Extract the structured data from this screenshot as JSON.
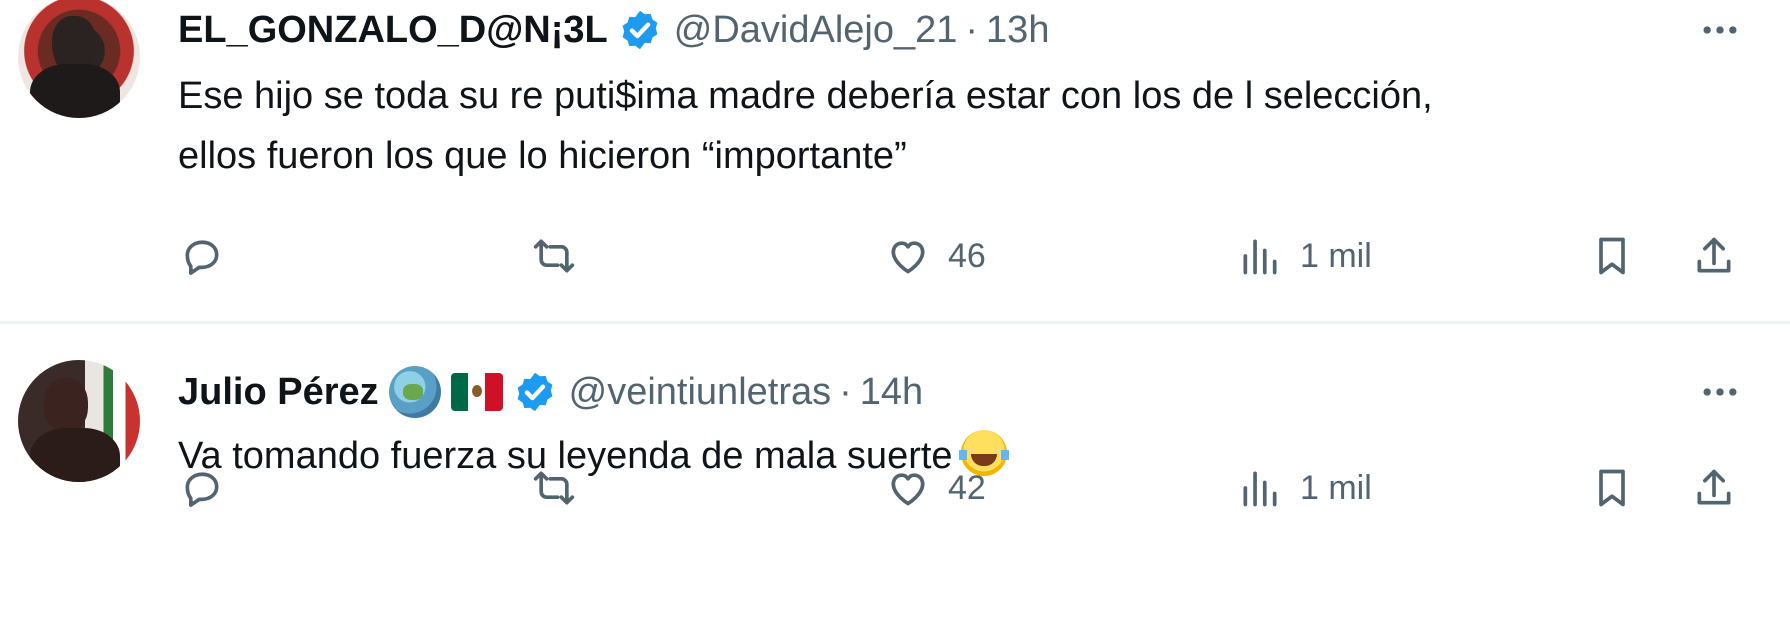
{
  "tweets": [
    {
      "name": "EL_GONZALO_D@N¡3L",
      "handle": "@DavidAlejo_21",
      "separator": "·",
      "time": "13h",
      "text_line1": "Ese hijo se toda su re puti$ima madre debería estar con los de l selección,",
      "text_line2": "ellos fueron los que lo hicieron “importante”",
      "likes": "46",
      "views": "1 mil"
    },
    {
      "name": "Julio Pérez",
      "handle": "@veintiunletras",
      "separator": "·",
      "time": "14h",
      "text": "Va tomando fuerza su leyenda de mala suerte",
      "emoji_name": "face-with-tears-of-joy",
      "likes": "42",
      "views": "1 mil"
    }
  ],
  "colors": {
    "verified": "#1d9bf0",
    "secondary_text": "#536471",
    "primary_text": "#0f1419",
    "divider": "#eff3f4"
  },
  "icons": [
    "verified-badge-icon",
    "more-icon",
    "reply-icon",
    "retweet-icon",
    "like-icon",
    "views-icon",
    "bookmark-icon",
    "share-icon",
    "globe-emoji",
    "mexico-flag-emoji"
  ]
}
